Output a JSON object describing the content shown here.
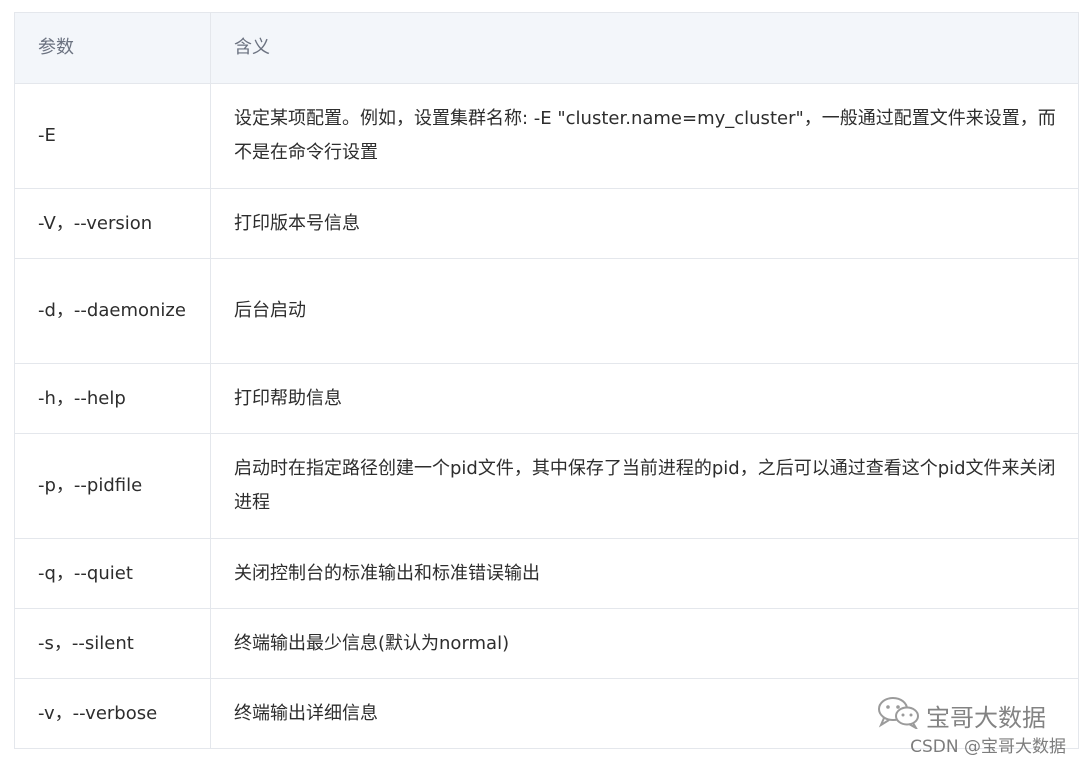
{
  "table": {
    "headers": [
      "参数",
      "含义"
    ],
    "rows": [
      {
        "param": "-E",
        "meaning": "设定某项配置。例如，设置集群名称: -E \"cluster.name=my_cluster\"，一般通过配置文件来设置，而不是在命令行设置"
      },
      {
        "param": "-V，--version",
        "meaning": "打印版本号信息"
      },
      {
        "param": "-d，--daemonize",
        "meaning": "后台启动"
      },
      {
        "param": "-h，--help",
        "meaning": "打印帮助信息"
      },
      {
        "param": "-p，--pidfile",
        "meaning": "启动时在指定路径创建一个pid文件，其中保存了当前进程的pid，之后可以通过查看这个pid文件来关闭进程"
      },
      {
        "param": "-q，--quiet",
        "meaning": "关闭控制台的标准输出和标准错误输出"
      },
      {
        "param": "-s，--silent",
        "meaning": "终端输出最少信息(默认为normal)"
      },
      {
        "param": "-v，--verbose",
        "meaning": "终端输出详细信息"
      }
    ]
  },
  "watermark": {
    "logo_icon": "wechat-icon",
    "account": "宝哥大数据",
    "csdn": "CSDN @宝哥大数据"
  }
}
